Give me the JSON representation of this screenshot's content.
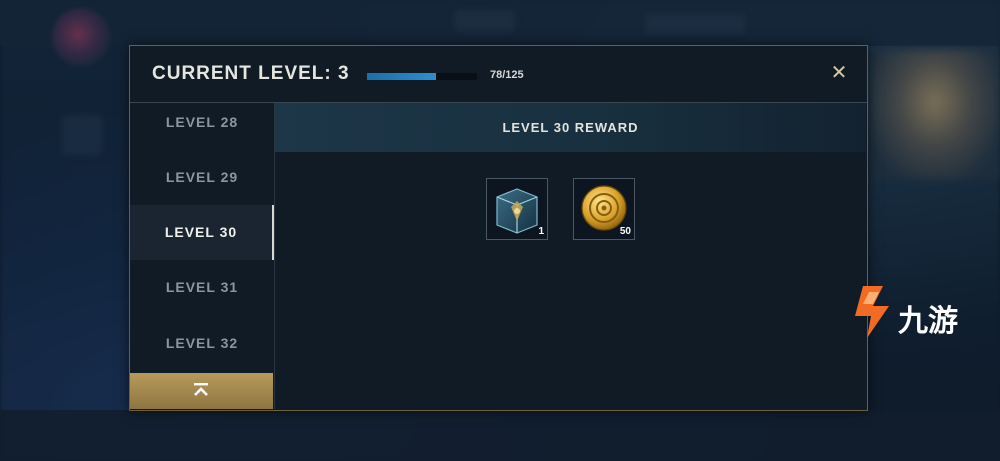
{
  "modal": {
    "title": "CURRENT LEVEL: 3",
    "xp_text": "78/125",
    "xp_progress": 0.624,
    "close_symbol": "✕"
  },
  "levels": [
    {
      "label": "LEVEL 28",
      "active": false
    },
    {
      "label": "LEVEL 29",
      "active": false
    },
    {
      "label": "LEVEL 30",
      "active": true
    },
    {
      "label": "LEVEL 31",
      "active": false
    },
    {
      "label": "LEVEL 32",
      "active": false
    }
  ],
  "reward": {
    "header": "LEVEL 30 REWARD",
    "items": [
      {
        "name": "hextech-chest",
        "count": "1"
      },
      {
        "name": "gold-coin",
        "count": "50"
      }
    ]
  },
  "watermark": {
    "text": "九游",
    "icon": "jiuyou-logo-icon"
  },
  "colors": {
    "accent_gold": "#b89a5c",
    "xp_blue": "#2d8ed0",
    "panel": "#111b25"
  }
}
